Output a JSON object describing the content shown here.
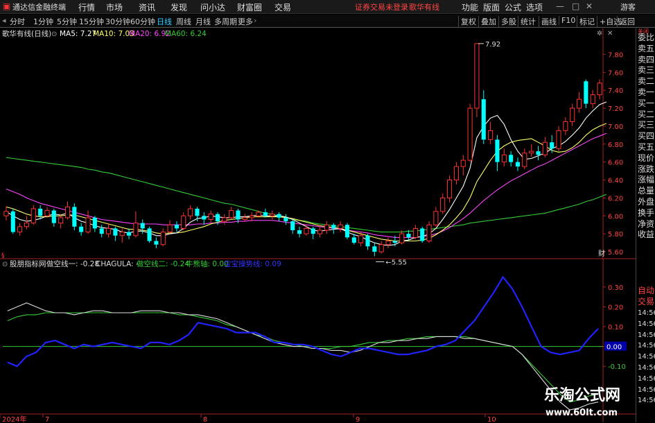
{
  "menubar": {
    "app_title": "通达信金融终端",
    "items": [
      "行情",
      "市场",
      "资讯",
      "发现",
      "问小达",
      "财富圈",
      "交易"
    ],
    "login_status": "证券交易未登录",
    "stock_name": "歌华有线",
    "right_items": [
      "功能",
      "版面",
      "公式",
      "选项"
    ],
    "guest": "游客"
  },
  "toolbar": {
    "periods": [
      "分时",
      "1分钟",
      "5分钟",
      "15分钟",
      "30分钟",
      "60分钟",
      "日线",
      "周线",
      "月线",
      "多周期",
      "更多"
    ],
    "active_period": "日线",
    "buttons": [
      "复权",
      "叠加",
      "多股",
      "统计",
      "画线",
      "F10",
      "标记",
      "+自选",
      "返回"
    ]
  },
  "main_chart": {
    "title": "歌华有线(日线)",
    "ma_labels": [
      {
        "text": "MA5: 7.27",
        "color": "#ffffff"
      },
      {
        "text": "MA10: 7.03",
        "color": "#ffff66"
      },
      {
        "text": "MA20: 6.92",
        "color": "#ff44ff"
      },
      {
        "text": "MA60: 6.24",
        "color": "#33cc33"
      }
    ],
    "high_label": "7.92",
    "low_label": "5.55",
    "y_ticks": [
      "7.80",
      "7.60",
      "7.40",
      "7.20",
      "7.00",
      "6.80",
      "6.60",
      "6.40",
      "6.20",
      "6.00",
      "5.80",
      "5.60"
    ],
    "corner_label": "财"
  },
  "indicator": {
    "title": "股朋指标网",
    "labels": [
      {
        "text": "做空线一: -0.28",
        "color": "#dddddd"
      },
      {
        "text": "CHAGULA: -",
        "color": "#dddddd"
      },
      {
        "text": "做空线二: -0.24",
        "color": "#33cc33"
      },
      {
        "text": "牛熊轴: 0.00",
        "color": "#33cc33"
      },
      {
        "text": "宝宝操势线: 0.09",
        "color": "#3333ff"
      }
    ],
    "y_ticks": [
      "0.30",
      "0.20",
      "0.10",
      "0.00",
      "-0.10"
    ],
    "zero_label": "0.00"
  },
  "x_axis": {
    "labels": [
      "2024年",
      "7",
      "8",
      "9",
      "10"
    ]
  },
  "right_panel": {
    "items": [
      "委比",
      "卖五",
      "卖四",
      "卖三",
      "卖二",
      "卖一",
      "买一",
      "买二",
      "买三",
      "买四",
      "买五",
      "现价",
      "涨跌",
      "涨幅",
      "总量",
      "外盘",
      "换手",
      "净资",
      "收益",
      "自动",
      "交易",
      "14:56",
      "14:56",
      "14:56",
      "14:56",
      "14:56",
      "14:56",
      "14:56",
      "14:56",
      "14:56"
    ]
  },
  "watermark": {
    "title": "乐淘公式网",
    "url": "www.60lt.com"
  },
  "colors": {
    "up": "#ff3333",
    "down": "#00ffff",
    "grid": "#551111",
    "axis": "#aa2222"
  },
  "chart_data": {
    "type": "candlestick",
    "title": "歌华有线(日线)",
    "ylim": [
      5.5,
      7.95
    ],
    "highest": 7.92,
    "lowest": 5.55,
    "candles": [
      {
        "o": 6.0,
        "c": 6.05,
        "h": 6.1,
        "l": 5.95
      },
      {
        "o": 6.05,
        "c": 5.82,
        "h": 6.08,
        "l": 5.8
      },
      {
        "o": 5.82,
        "c": 5.88,
        "h": 5.92,
        "l": 5.78
      },
      {
        "o": 5.88,
        "c": 5.92,
        "h": 6.0,
        "l": 5.85
      },
      {
        "o": 5.92,
        "c": 6.08,
        "h": 6.12,
        "l": 5.9
      },
      {
        "o": 6.08,
        "c": 6.0,
        "h": 6.12,
        "l": 5.96
      },
      {
        "o": 6.0,
        "c": 6.06,
        "h": 6.1,
        "l": 5.98
      },
      {
        "o": 6.06,
        "c": 5.92,
        "h": 6.08,
        "l": 5.88
      },
      {
        "o": 5.92,
        "c": 5.98,
        "h": 6.02,
        "l": 5.86
      },
      {
        "o": 5.98,
        "c": 6.1,
        "h": 6.16,
        "l": 5.96
      },
      {
        "o": 6.1,
        "c": 5.88,
        "h": 6.14,
        "l": 5.84
      },
      {
        "o": 5.88,
        "c": 5.82,
        "h": 5.92,
        "l": 5.78
      },
      {
        "o": 5.82,
        "c": 5.98,
        "h": 6.06,
        "l": 5.8
      },
      {
        "o": 5.98,
        "c": 5.86,
        "h": 6.0,
        "l": 5.82
      },
      {
        "o": 5.86,
        "c": 5.8,
        "h": 5.9,
        "l": 5.76
      },
      {
        "o": 5.8,
        "c": 5.86,
        "h": 5.92,
        "l": 5.76
      },
      {
        "o": 5.86,
        "c": 5.78,
        "h": 5.88,
        "l": 5.72
      },
      {
        "o": 5.78,
        "c": 5.82,
        "h": 5.86,
        "l": 5.7
      },
      {
        "o": 5.82,
        "c": 5.78,
        "h": 5.86,
        "l": 5.74
      },
      {
        "o": 5.78,
        "c": 5.92,
        "h": 6.05,
        "l": 5.76
      },
      {
        "o": 5.92,
        "c": 5.86,
        "h": 5.96,
        "l": 5.8
      },
      {
        "o": 5.86,
        "c": 5.72,
        "h": 5.88,
        "l": 5.7
      },
      {
        "o": 5.72,
        "c": 5.68,
        "h": 5.76,
        "l": 5.64
      },
      {
        "o": 5.68,
        "c": 5.82,
        "h": 5.86,
        "l": 5.66
      },
      {
        "o": 5.82,
        "c": 5.9,
        "h": 5.95,
        "l": 5.8
      },
      {
        "o": 5.9,
        "c": 5.86,
        "h": 5.94,
        "l": 5.82
      },
      {
        "o": 5.86,
        "c": 6.0,
        "h": 6.04,
        "l": 5.84
      },
      {
        "o": 6.0,
        "c": 6.08,
        "h": 6.12,
        "l": 5.96
      },
      {
        "o": 6.08,
        "c": 6.0,
        "h": 6.1,
        "l": 5.94
      },
      {
        "o": 6.0,
        "c": 5.96,
        "h": 6.04,
        "l": 5.9
      },
      {
        "o": 5.96,
        "c": 6.02,
        "h": 6.06,
        "l": 5.92
      },
      {
        "o": 6.02,
        "c": 5.94,
        "h": 6.04,
        "l": 5.9
      },
      {
        "o": 5.94,
        "c": 5.98,
        "h": 6.02,
        "l": 5.9
      },
      {
        "o": 5.98,
        "c": 6.06,
        "h": 6.1,
        "l": 5.96
      },
      {
        "o": 6.06,
        "c": 5.96,
        "h": 6.08,
        "l": 5.92
      },
      {
        "o": 5.96,
        "c": 5.98,
        "h": 6.02,
        "l": 5.94
      },
      {
        "o": 5.98,
        "c": 6.0,
        "h": 6.04,
        "l": 5.94
      },
      {
        "o": 6.0,
        "c": 6.04,
        "h": 6.06,
        "l": 5.98
      },
      {
        "o": 6.04,
        "c": 6.0,
        "h": 6.08,
        "l": 5.98
      },
      {
        "o": 6.0,
        "c": 6.02,
        "h": 6.06,
        "l": 5.96
      },
      {
        "o": 6.02,
        "c": 5.98,
        "h": 6.04,
        "l": 5.94
      },
      {
        "o": 5.98,
        "c": 5.94,
        "h": 6.02,
        "l": 5.9
      },
      {
        "o": 5.94,
        "c": 5.84,
        "h": 5.96,
        "l": 5.8
      },
      {
        "o": 5.84,
        "c": 5.8,
        "h": 5.88,
        "l": 5.76
      },
      {
        "o": 5.8,
        "c": 5.86,
        "h": 5.9,
        "l": 5.78
      },
      {
        "o": 5.86,
        "c": 5.8,
        "h": 5.88,
        "l": 5.74
      },
      {
        "o": 5.8,
        "c": 5.84,
        "h": 5.9,
        "l": 5.76
      },
      {
        "o": 5.84,
        "c": 5.9,
        "h": 5.94,
        "l": 5.8
      },
      {
        "o": 5.9,
        "c": 5.86,
        "h": 5.92,
        "l": 5.8
      },
      {
        "o": 5.86,
        "c": 5.9,
        "h": 5.94,
        "l": 5.82
      },
      {
        "o": 5.9,
        "c": 5.76,
        "h": 5.92,
        "l": 5.74
      },
      {
        "o": 5.76,
        "c": 5.7,
        "h": 5.8,
        "l": 5.68
      },
      {
        "o": 5.7,
        "c": 5.78,
        "h": 5.82,
        "l": 5.66
      },
      {
        "o": 5.78,
        "c": 5.66,
        "h": 5.8,
        "l": 5.62
      },
      {
        "o": 5.66,
        "c": 5.6,
        "h": 5.7,
        "l": 5.55
      },
      {
        "o": 5.6,
        "c": 5.68,
        "h": 5.72,
        "l": 5.58
      },
      {
        "o": 5.68,
        "c": 5.72,
        "h": 5.76,
        "l": 5.64
      },
      {
        "o": 5.72,
        "c": 5.7,
        "h": 5.78,
        "l": 5.66
      },
      {
        "o": 5.7,
        "c": 5.8,
        "h": 5.84,
        "l": 5.68
      },
      {
        "o": 5.8,
        "c": 5.76,
        "h": 5.84,
        "l": 5.72
      },
      {
        "o": 5.76,
        "c": 5.86,
        "h": 5.9,
        "l": 5.74
      },
      {
        "o": 5.86,
        "c": 5.72,
        "h": 5.88,
        "l": 5.7
      },
      {
        "o": 5.72,
        "c": 5.9,
        "h": 5.94,
        "l": 5.7
      },
      {
        "o": 5.9,
        "c": 6.05,
        "h": 6.1,
        "l": 5.88
      },
      {
        "o": 6.05,
        "c": 6.2,
        "h": 6.25,
        "l": 6.02
      },
      {
        "o": 6.2,
        "c": 6.4,
        "h": 6.45,
        "l": 6.15
      },
      {
        "o": 6.4,
        "c": 6.55,
        "h": 6.6,
        "l": 6.35
      },
      {
        "o": 6.55,
        "c": 6.62,
        "h": 6.68,
        "l": 6.45
      },
      {
        "o": 6.62,
        "c": 7.2,
        "h": 7.25,
        "l": 6.6
      },
      {
        "o": 7.2,
        "c": 7.92,
        "h": 7.92,
        "l": 7.1
      },
      {
        "o": 7.3,
        "c": 6.85,
        "h": 7.4,
        "l": 6.8
      },
      {
        "o": 6.85,
        "c": 6.95,
        "h": 7.05,
        "l": 6.8
      },
      {
        "o": 6.85,
        "c": 6.6,
        "h": 6.9,
        "l": 6.5
      },
      {
        "o": 6.6,
        "c": 6.68,
        "h": 6.75,
        "l": 6.55
      },
      {
        "o": 6.68,
        "c": 6.6,
        "h": 6.72,
        "l": 6.55
      },
      {
        "o": 6.6,
        "c": 6.55,
        "h": 6.65,
        "l": 6.5
      },
      {
        "o": 6.55,
        "c": 6.7,
        "h": 6.75,
        "l": 6.52
      },
      {
        "o": 6.7,
        "c": 6.72,
        "h": 6.8,
        "l": 6.66
      },
      {
        "o": 6.72,
        "c": 6.68,
        "h": 6.78,
        "l": 6.62
      },
      {
        "o": 6.68,
        "c": 6.82,
        "h": 6.88,
        "l": 6.65
      },
      {
        "o": 6.82,
        "c": 6.75,
        "h": 6.9,
        "l": 6.7
      },
      {
        "o": 6.75,
        "c": 6.95,
        "h": 7.0,
        "l": 6.72
      },
      {
        "o": 6.95,
        "c": 7.05,
        "h": 7.1,
        "l": 6.9
      },
      {
        "o": 7.05,
        "c": 7.2,
        "h": 7.25,
        "l": 7.0
      },
      {
        "o": 7.2,
        "c": 7.3,
        "h": 7.38,
        "l": 7.15
      },
      {
        "o": 7.5,
        "c": 7.25,
        "h": 7.52,
        "l": 7.2
      },
      {
        "o": 7.25,
        "c": 7.35,
        "h": 7.4,
        "l": 7.2
      },
      {
        "o": 7.35,
        "c": 7.48,
        "h": 7.52,
        "l": 7.3
      }
    ],
    "ma5": [
      6.05,
      6.0,
      5.96,
      5.94,
      5.95,
      5.97,
      6.0,
      6.02,
      6.01,
      6.03,
      5.98,
      5.94,
      5.92,
      5.89,
      5.87,
      5.86,
      5.85,
      5.82,
      5.81,
      5.83,
      5.83,
      5.81,
      5.78,
      5.78,
      5.8,
      5.81,
      5.86,
      5.93,
      5.97,
      5.98,
      6.0,
      5.99,
      5.98,
      5.98,
      5.99,
      5.99,
      6.0,
      6.01,
      6.0,
      6.0,
      6.0,
      5.99,
      5.96,
      5.92,
      5.88,
      5.84,
      5.83,
      5.84,
      5.85,
      5.86,
      5.82,
      5.79,
      5.77,
      5.73,
      5.7,
      5.68,
      5.67,
      5.68,
      5.72,
      5.73,
      5.76,
      5.77,
      5.8,
      5.86,
      5.96,
      6.07,
      6.2,
      6.33,
      6.53,
      6.87,
      7.0,
      7.09,
      7.12,
      7.02,
      6.85,
      6.72,
      6.63,
      6.64,
      6.67,
      6.7,
      6.75,
      6.78,
      6.83,
      6.9,
      6.98,
      7.09,
      7.17,
      7.24,
      7.27
    ],
    "ma10": [
      6.1,
      6.08,
      6.05,
      6.02,
      6.0,
      5.99,
      5.99,
      6.0,
      6.0,
      6.01,
      6.01,
      5.99,
      5.97,
      5.95,
      5.93,
      5.91,
      5.89,
      5.87,
      5.85,
      5.85,
      5.84,
      5.83,
      5.81,
      5.8,
      5.81,
      5.81,
      5.82,
      5.84,
      5.86,
      5.88,
      5.91,
      5.93,
      5.95,
      5.96,
      5.97,
      5.98,
      5.99,
      5.99,
      5.99,
      5.99,
      5.99,
      5.98,
      5.97,
      5.95,
      5.93,
      5.91,
      5.89,
      5.88,
      5.87,
      5.86,
      5.84,
      5.82,
      5.8,
      5.78,
      5.76,
      5.74,
      5.73,
      5.72,
      5.72,
      5.72,
      5.72,
      5.73,
      5.75,
      5.79,
      5.84,
      5.9,
      5.98,
      6.07,
      6.2,
      6.38,
      6.5,
      6.62,
      6.72,
      6.78,
      6.82,
      6.84,
      6.85,
      6.86,
      6.82,
      6.78,
      6.73,
      6.71,
      6.72,
      6.76,
      6.82,
      6.9,
      6.96,
      7.0,
      7.03
    ],
    "ma20": [
      6.3,
      6.27,
      6.24,
      6.2,
      6.17,
      6.14,
      6.12,
      6.1,
      6.08,
      6.06,
      6.04,
      6.02,
      6.0,
      5.98,
      5.96,
      5.95,
      5.94,
      5.93,
      5.92,
      5.91,
      5.91,
      5.91,
      5.91,
      5.9,
      5.9,
      5.9,
      5.9,
      5.9,
      5.91,
      5.91,
      5.92,
      5.92,
      5.93,
      5.93,
      5.94,
      5.94,
      5.95,
      5.95,
      5.95,
      5.95,
      5.94,
      5.93,
      5.92,
      5.91,
      5.9,
      5.89,
      5.88,
      5.87,
      5.86,
      5.85,
      5.84,
      5.83,
      5.82,
      5.81,
      5.79,
      5.78,
      5.77,
      5.76,
      5.76,
      5.76,
      5.76,
      5.77,
      5.78,
      5.8,
      5.83,
      5.87,
      5.92,
      5.97,
      6.03,
      6.1,
      6.17,
      6.23,
      6.29,
      6.34,
      6.39,
      6.43,
      6.47,
      6.51,
      6.55,
      6.58,
      6.62,
      6.66,
      6.7,
      6.74,
      6.78,
      6.82,
      6.86,
      6.89,
      6.92
    ],
    "ma60": [
      6.65,
      6.64,
      6.63,
      6.62,
      6.61,
      6.6,
      6.59,
      6.58,
      6.57,
      6.56,
      6.55,
      6.54,
      6.52,
      6.51,
      6.49,
      6.48,
      6.46,
      6.44,
      6.42,
      6.4,
      6.38,
      6.36,
      6.34,
      6.32,
      6.3,
      6.28,
      6.26,
      6.24,
      6.22,
      6.2,
      6.18,
      6.16,
      6.14,
      6.13,
      6.11,
      6.09,
      6.07,
      6.05,
      6.03,
      6.02,
      6.0,
      5.98,
      5.96,
      5.95,
      5.94,
      5.92,
      5.91,
      5.9,
      5.89,
      5.88,
      5.87,
      5.86,
      5.85,
      5.84,
      5.83,
      5.82,
      5.82,
      5.82,
      5.82,
      5.83,
      5.83,
      5.84,
      5.85,
      5.86,
      5.87,
      5.88,
      5.89,
      5.9,
      5.92,
      5.93,
      5.94,
      5.95,
      5.96,
      5.97,
      5.98,
      5.99,
      6.0,
      6.01,
      6.02,
      6.03,
      6.05,
      6.07,
      6.09,
      6.11,
      6.13,
      6.16,
      6.18,
      6.21,
      6.24
    ],
    "indicator": {
      "ylim": [
        -0.33,
        0.38
      ],
      "white_line": [
        0.18,
        0.2,
        0.22,
        0.2,
        0.18,
        0.17,
        0.17,
        0.16,
        0.17,
        0.18,
        0.18,
        0.17,
        0.17,
        0.17,
        0.18,
        0.18,
        0.18,
        0.17,
        0.17,
        0.16,
        0.16,
        0.15,
        0.14,
        0.12,
        0.1,
        0.08,
        0.06,
        0.04,
        0.02,
        0.01,
        0.0,
        0.0,
        -0.01,
        -0.01,
        -0.02,
        -0.02,
        -0.03,
        -0.02,
        0.0,
        0.02,
        0.02,
        0.03,
        0.03,
        0.04,
        0.04,
        0.05,
        0.05,
        0.05,
        0.04,
        0.04,
        0.03,
        0.02,
        0.01,
        0.0,
        -0.04,
        -0.1,
        -0.16,
        -0.22,
        -0.28,
        -0.32,
        -0.31,
        -0.29,
        -0.28
      ],
      "green_line": [
        0.13,
        0.15,
        0.16,
        0.16,
        0.17,
        0.17,
        0.17,
        0.17,
        0.17,
        0.17,
        0.17,
        0.17,
        0.17,
        0.17,
        0.17,
        0.17,
        0.17,
        0.17,
        0.16,
        0.16,
        0.15,
        0.14,
        0.13,
        0.11,
        0.1,
        0.08,
        0.06,
        0.05,
        0.03,
        0.02,
        0.01,
        0.0,
        -0.01,
        -0.01,
        -0.01,
        0.0,
        0.0,
        0.01,
        0.02,
        0.02,
        0.03,
        0.03,
        0.04,
        0.04,
        0.05,
        0.05,
        0.05,
        0.05,
        0.05,
        0.04,
        0.03,
        0.02,
        0.01,
        0.0,
        -0.04,
        -0.09,
        -0.14,
        -0.19,
        -0.24,
        -0.28,
        -0.27,
        -0.25,
        -0.24
      ],
      "blue_line": [
        -0.08,
        -0.1,
        -0.05,
        -0.03,
        0.02,
        0.03,
        0.01,
        -0.01,
        0.01,
        0.0,
        0.01,
        0.02,
        0.01,
        0.0,
        -0.01,
        0.02,
        0.02,
        0.01,
        0.03,
        0.06,
        0.12,
        0.11,
        0.1,
        0.09,
        0.07,
        0.07,
        0.07,
        0.05,
        0.02,
        0.02,
        0.01,
        0.01,
        0.0,
        -0.02,
        -0.04,
        -0.05,
        -0.03,
        -0.01,
        -0.01,
        -0.02,
        -0.03,
        -0.04,
        -0.04,
        -0.03,
        -0.02,
        0.0,
        0.01,
        0.03,
        0.08,
        0.13,
        0.2,
        0.27,
        0.35,
        0.29,
        0.2,
        0.1,
        0.0,
        -0.03,
        -0.04,
        -0.03,
        -0.02,
        0.04,
        0.09
      ],
      "zero_line": 0.0
    }
  }
}
